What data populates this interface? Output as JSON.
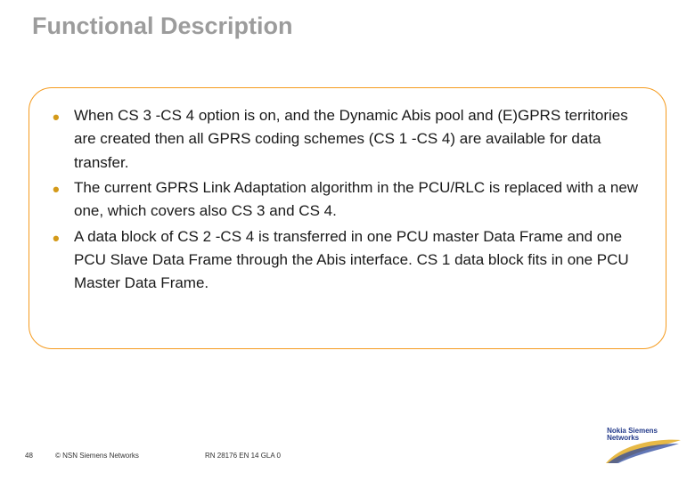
{
  "title": "Functional Description",
  "bullets": [
    "When CS 3 -CS 4 option is on, and the Dynamic Abis pool and (E)GPRS territories are created then all GPRS coding schemes (CS 1 -CS 4) are available for data transfer.",
    "The current GPRS Link Adaptation algorithm in the PCU/RLC is replaced with a new one, which covers also CS 3 and CS 4.",
    "A data block of CS 2 -CS 4 is transferred in one PCU master Data Frame and one PCU Slave Data Frame through the Abis interface. CS 1 data block fits in one PCU Master Data Frame."
  ],
  "footer": {
    "page": "48",
    "copyright": "© NSN Siemens Networks",
    "refcode": "RN 28176 EN 14 GLA 0"
  },
  "logo": {
    "line1": "Nokia Siemens",
    "line2": "Networks"
  }
}
